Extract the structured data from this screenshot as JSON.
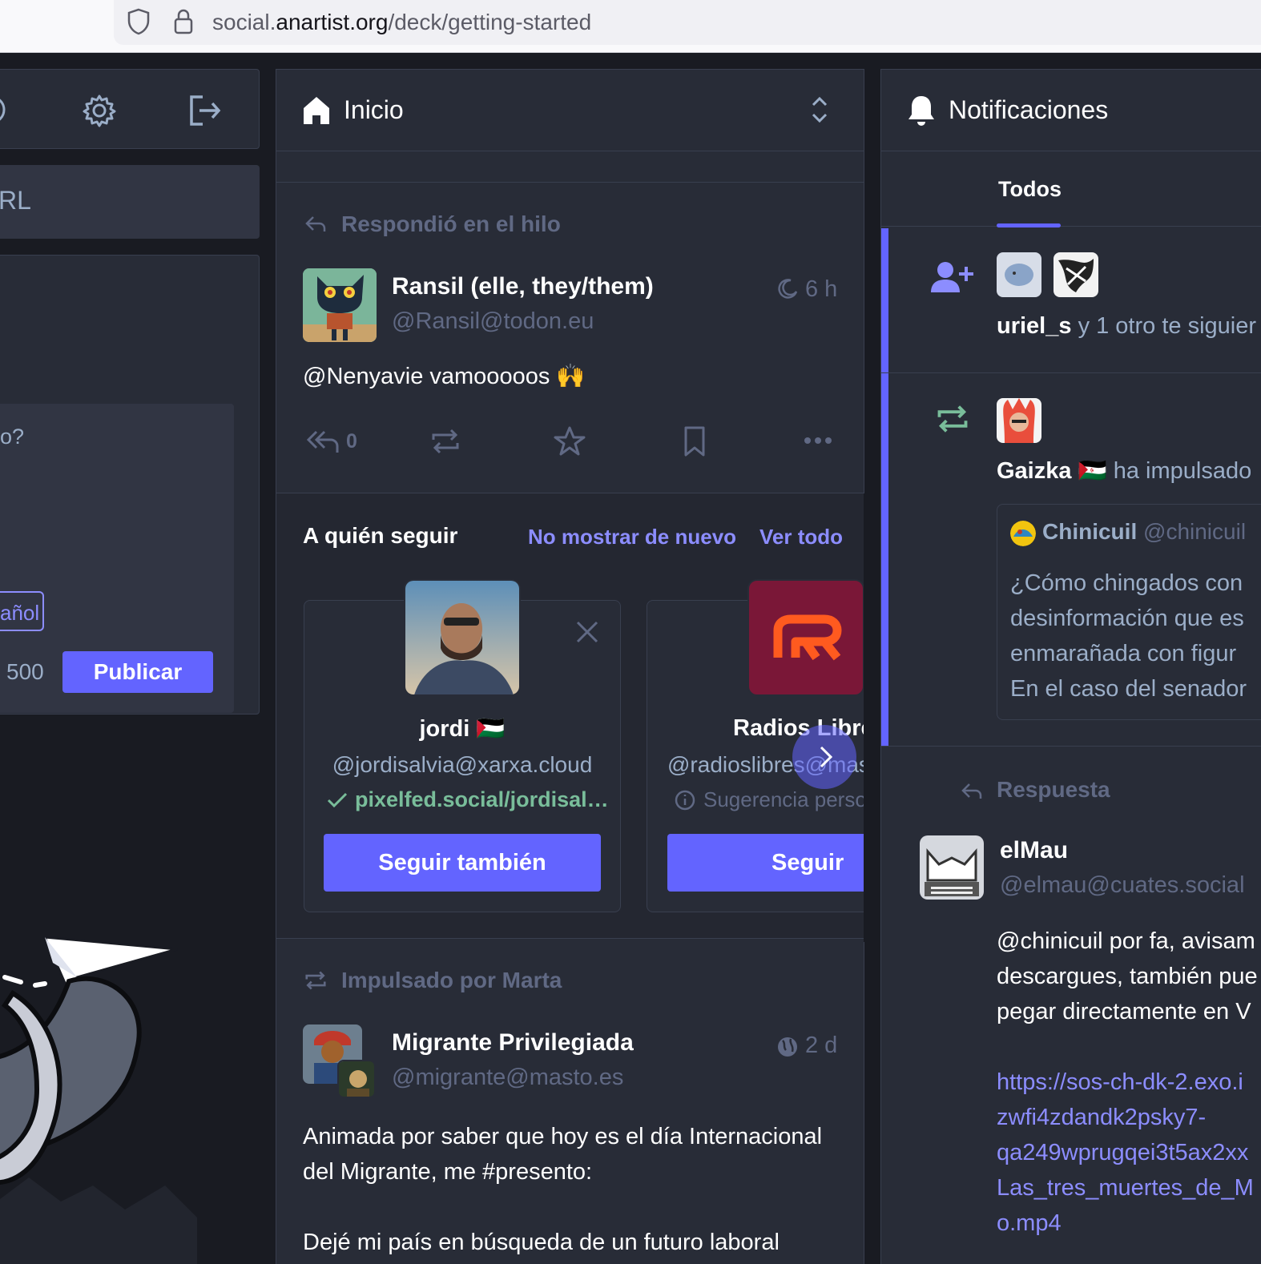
{
  "browser": {
    "url_prefix": "social.",
    "url_domain": "anartist.org",
    "url_path": "/deck/getting-started"
  },
  "left": {
    "search_placeholder": "RL",
    "compose_placeholder": "o?",
    "language": "añol",
    "char_count": "500",
    "publish_label": "Publicar"
  },
  "home": {
    "title": "Inicio",
    "post1": {
      "context": "Respondió en el hilo",
      "display_name": "Ransil (elle, they/them)",
      "handle": "@Ransil@todon.eu",
      "time": "6 h",
      "content": "@Nenyavie vamooooos 🙌",
      "reply_count": "0"
    },
    "follow": {
      "title": "A quién seguir",
      "dismiss": "No mostrar de nuevo",
      "view_all": "Ver todo",
      "cards": [
        {
          "name": "jordi 🇵🇸",
          "handle": "@jordisalvia@xarxa.cloud",
          "meta": "pixelfed.social/jordisal…",
          "button": "Seguir también"
        },
        {
          "name": "Radios Libre",
          "handle": "@radioslibres@mas",
          "meta": "Sugerencia perso",
          "button": "Seguir"
        }
      ]
    },
    "post2": {
      "context": "Impulsado por Marta",
      "display_name": "Migrante Privilegiada",
      "handle": "@migrante@masto.es",
      "time": "2 d",
      "content1": "Animada por saber que hoy es el día Internacional del Migrante, me #presento:",
      "content2": "Dejé mi país en búsqueda de un futuro laboral"
    }
  },
  "notifications": {
    "title": "Notificaciones",
    "tab": "Todos",
    "follow": {
      "user": "uriel_s",
      "rest": "y 1 otro te siguier"
    },
    "boost": {
      "user": "Gaizka 🇪🇭",
      "rest": "ha impulsado",
      "quoted_name": "Chinicuil",
      "quoted_handle": "@chinicuil",
      "quoted_lines": [
        "¿Cómo chingados con",
        "desinformación que es",
        "enmarañada con figur",
        "En el caso del senador"
      ]
    },
    "reply": {
      "context": "Respuesta",
      "display_name": "elMau",
      "handle": "@elmau@cuates.social",
      "lines": [
        "@chinicuil por fa, avisam",
        "descargues, también pue",
        "pegar directamente en V"
      ],
      "link_lines": [
        "https://sos-ch-dk-2.exo.i",
        "zwfi4zdandk2psky7-",
        "qa249wprugqei3t5ax2xx",
        "Las_tres_muertes_de_M",
        "o.mp4"
      ]
    }
  },
  "colors": {
    "accent": "#6364ff",
    "link": "#8c8dff",
    "background": "#191b22",
    "column": "#282c37",
    "verified": "#79bd9a"
  }
}
